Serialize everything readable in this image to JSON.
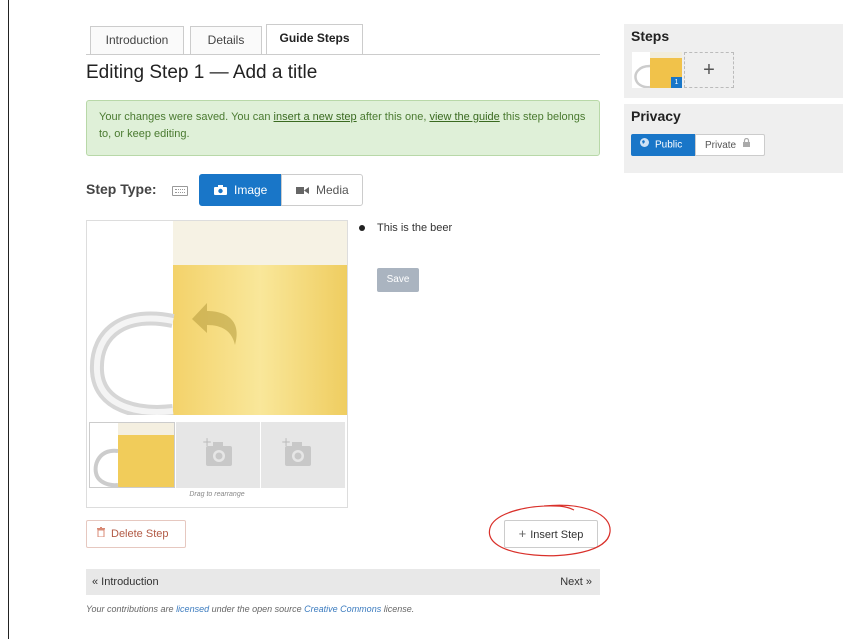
{
  "tabs": [
    {
      "label": "Introduction"
    },
    {
      "label": "Details"
    },
    {
      "label": "Guide Steps",
      "active": true
    }
  ],
  "page_title": "Editing Step 1 — Add a title",
  "alert": {
    "text_1": "Your changes were saved. You can ",
    "link_insert": "insert a new step",
    "text_2": " after this one, ",
    "link_view": "view the guide",
    "text_3": " this step belongs to, or keep editing."
  },
  "step_type": {
    "label": "Step Type:",
    "image_label": "Image",
    "media_label": "Media"
  },
  "image_area": {
    "drag_hint": "Drag to rearrange"
  },
  "bullet": {
    "text": "This is the beer"
  },
  "save_label": "Save",
  "delete_label": "Delete Step",
  "insert_label": "Insert Step",
  "nav": {
    "prev": "« Introduction",
    "next": "Next »"
  },
  "footer": {
    "t1": "Your contributions are ",
    "link_licensed": "licensed",
    "t2": " under the open source ",
    "link_cc": "Creative Commons",
    "t3": " license."
  },
  "sidebar": {
    "steps_title": "Steps",
    "step_number": "1",
    "add_symbol": "+",
    "privacy_title": "Privacy",
    "public_label": "Public",
    "private_label": "Private"
  },
  "colors": {
    "accent": "#1976c8",
    "alert_bg": "#dff0d8",
    "annotation": "#d9302a"
  },
  "icons": [
    "keyboard-icon",
    "camera-icon",
    "video-icon",
    "trash-icon",
    "plus-icon",
    "globe-icon",
    "lock-icon",
    "undo-arrow-icon",
    "add-photo-icon"
  ]
}
